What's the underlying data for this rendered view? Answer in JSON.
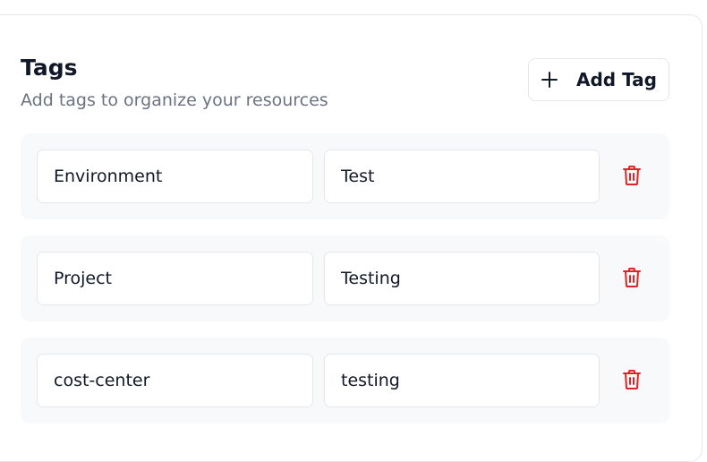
{
  "section": {
    "title": "Tags",
    "subtitle": "Add tags to organize your resources",
    "add_button_label": "Add Tag"
  },
  "tags": [
    {
      "key": "Environment",
      "value": "Test"
    },
    {
      "key": "Project",
      "value": "Testing"
    },
    {
      "key": "cost-center",
      "value": "testing"
    }
  ],
  "colors": {
    "delete_icon": "#dc2626",
    "row_background": "#f8f9fb",
    "border": "#e5e7eb"
  },
  "icons": {
    "add": "plus-icon",
    "delete": "trash-icon"
  }
}
